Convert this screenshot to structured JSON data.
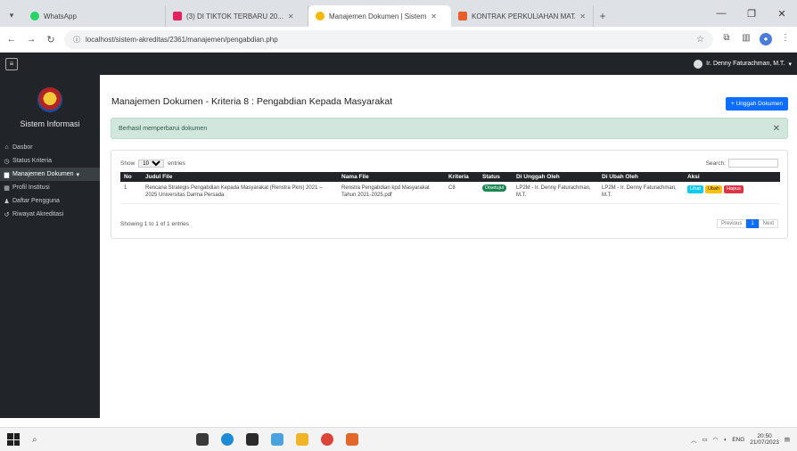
{
  "browser": {
    "tabs": [
      {
        "title": "WhatsApp",
        "color": "#25d366",
        "active": false
      },
      {
        "title": "(3) DI TIKTOK TERBARU 20...",
        "color": "#e0245e",
        "active": false
      },
      {
        "title": "Manajemen Dokumen | Sistem",
        "color": "#f5b800",
        "active": true
      },
      {
        "title": "KONTRAK PERKULIAHAN MATA...",
        "color": "#e85d2a",
        "active": false
      }
    ],
    "url": "localhost/sistem-akreditas/2361/manajemen/pengabdian.php"
  },
  "navbar": {
    "user_name": "Ir. Denny Faturachman, M.T."
  },
  "sidebar": {
    "brand": "Sistem Informasi",
    "items": [
      {
        "label": "Dasbor",
        "icon": "home-icon"
      },
      {
        "label": "Status Kriteria",
        "icon": "clock-icon"
      },
      {
        "label": "Manajemen Dokumen",
        "icon": "folder-icon"
      },
      {
        "label": "Profil Institusi",
        "icon": "building-icon"
      },
      {
        "label": "Daftar Pengguna",
        "icon": "users-icon"
      },
      {
        "label": "Riwayat Akreditasi",
        "icon": "history-icon"
      }
    ]
  },
  "main": {
    "title": "Manajemen Dokumen - Kriteria 8 : Pengabdian Kepada Masyarakat",
    "upload_label": "+ Unggah Dokumen",
    "alert_text": "Berhasil memperbarui dokumen",
    "show_label": "Show",
    "show_value": "10",
    "entries_label": "entries",
    "search_label": "Search:",
    "table": {
      "headers": [
        "No",
        "Judul File",
        "Nama File",
        "Kriteria",
        "Status",
        "Di Unggah Oleh",
        "Di Ubah Oleh",
        "Aksi"
      ],
      "rows": [
        {
          "no": "1",
          "judul": "Rencana Strategis Pengabdian Kepada Masyarakat (Renstra Pkm) 2021 – 2025 Universitas Darma Persada",
          "nama": "Renstra Pengabdian kpd Masyarakat Tahun 2021-2025.pdf",
          "kriteria": "C8",
          "status": "Disetujui",
          "uploader": "LP2M - Ir. Denny Faturachman, M.T.",
          "editor": "LP2M - Ir. Denny Faturachman, M.T.",
          "actions": [
            "Lihat",
            "Ubah",
            "Hapus"
          ]
        }
      ]
    },
    "info": "Showing 1 to 1 of 1 entries",
    "pager": {
      "prev": "Previous",
      "current": "1",
      "next": "Next"
    }
  },
  "taskbar": {
    "lang": "ENG",
    "time": "20:50",
    "date": "21/07/2023"
  }
}
